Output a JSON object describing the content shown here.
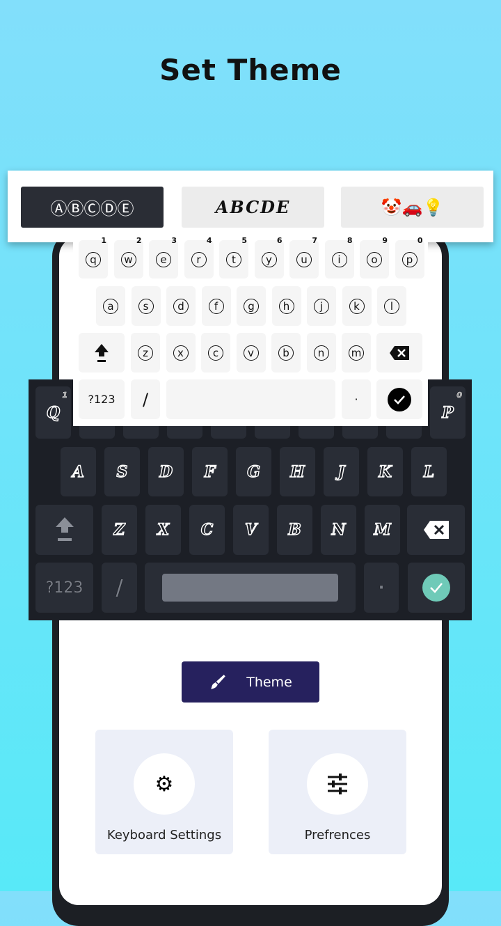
{
  "page_title": "Set Theme",
  "font_options": [
    {
      "label": "ⒶⒷⒸⒹⒺ",
      "selected": true
    },
    {
      "label": "ABCDE",
      "selected": false
    },
    {
      "label": "🤡🚗💡",
      "selected": false
    }
  ],
  "light_keyboard": {
    "row1": [
      "q",
      "w",
      "e",
      "r",
      "t",
      "y",
      "u",
      "i",
      "o",
      "p"
    ],
    "hints": [
      "1",
      "2",
      "3",
      "4",
      "5",
      "6",
      "7",
      "8",
      "9",
      "0"
    ],
    "row2": [
      "a",
      "s",
      "d",
      "f",
      "g",
      "h",
      "j",
      "k",
      "l"
    ],
    "row3": [
      "z",
      "x",
      "c",
      "v",
      "b",
      "n",
      "m"
    ],
    "symbols_label": "?123",
    "slash": "/",
    "period": "·"
  },
  "dark_keyboard": {
    "row1_visible": [
      "Q",
      "P"
    ],
    "row1_hints": [
      "1",
      "0"
    ],
    "row2": [
      "A",
      "S",
      "D",
      "F",
      "G",
      "H",
      "J",
      "K",
      "L"
    ],
    "row3": [
      "Z",
      "X",
      "C",
      "V",
      "B",
      "N",
      "M"
    ],
    "symbols_label": "?123",
    "slash": "/",
    "period": "·",
    "enter_color": "#6fcab8"
  },
  "theme_button": {
    "label": "Theme",
    "icon": "paintbrush-icon",
    "color": "#26215e"
  },
  "cards": [
    {
      "label": "Keyboard Settings",
      "icon": "gear-icon"
    },
    {
      "label": "Prefrences",
      "icon": "sliders-icon"
    }
  ]
}
